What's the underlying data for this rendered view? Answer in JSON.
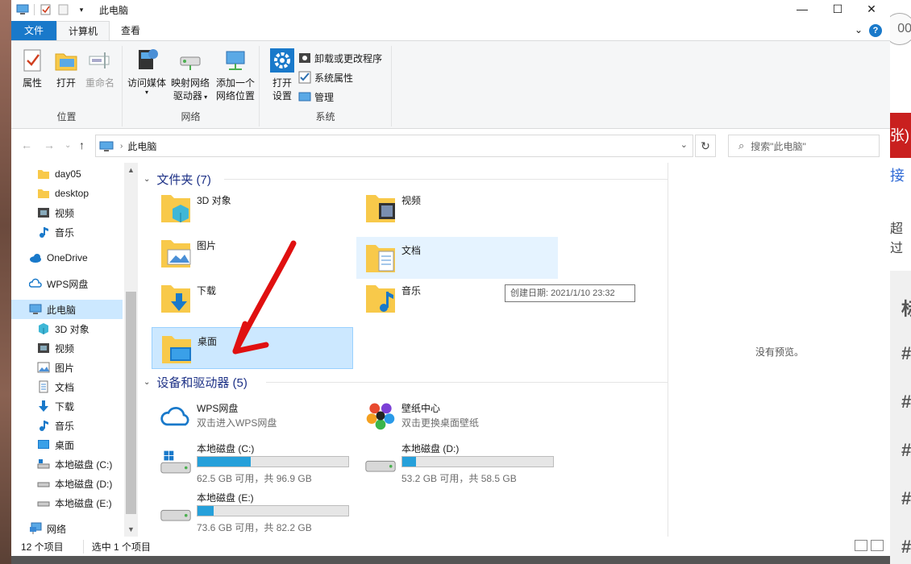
{
  "window": {
    "title": "此电脑",
    "controls": {
      "minimize": "—",
      "maximize": "☐",
      "close": "✕"
    }
  },
  "ribbon_tabs": {
    "file": "文件",
    "computer": "计算机",
    "view": "查看"
  },
  "ribbon": {
    "location": {
      "label": "位置",
      "properties": "属性",
      "open": "打开",
      "rename": "重命名"
    },
    "network": {
      "label": "网络",
      "access_media": "访问媒体",
      "map_drive_line1": "映射网络",
      "map_drive_line2": "驱动器",
      "add_location_line1": "添加一个",
      "add_location_line2": "网络位置"
    },
    "system": {
      "label": "系统",
      "open_settings_line1": "打开",
      "open_settings_line2": "设置",
      "uninstall": "卸载或更改程序",
      "system_props": "系统属性",
      "manage": "管理"
    }
  },
  "address": {
    "crumb": "此电脑",
    "search_placeholder": "搜索\"此电脑\""
  },
  "nav": {
    "items": [
      {
        "label": "day05",
        "icon": "folder-icon"
      },
      {
        "label": "desktop",
        "icon": "folder-icon"
      },
      {
        "label": "视频",
        "icon": "video-icon"
      },
      {
        "label": "音乐",
        "icon": "music-icon"
      },
      {
        "label": "OneDrive",
        "icon": "cloud-icon"
      },
      {
        "label": "WPS网盘",
        "icon": "wps-cloud-icon"
      },
      {
        "label": "此电脑",
        "icon": "computer-icon"
      },
      {
        "label": "3D 对象",
        "icon": "cube-icon"
      },
      {
        "label": "视频",
        "icon": "video-icon"
      },
      {
        "label": "图片",
        "icon": "picture-icon"
      },
      {
        "label": "文档",
        "icon": "document-icon"
      },
      {
        "label": "下载",
        "icon": "download-icon"
      },
      {
        "label": "音乐",
        "icon": "music-icon"
      },
      {
        "label": "桌面",
        "icon": "desktop-icon"
      },
      {
        "label": "本地磁盘 (C:)",
        "icon": "drive-icon"
      },
      {
        "label": "本地磁盘 (D:)",
        "icon": "drive-icon"
      },
      {
        "label": "本地磁盘 (E:)",
        "icon": "drive-icon"
      },
      {
        "label": "网络",
        "icon": "network-icon"
      }
    ]
  },
  "folders_section": {
    "title": "文件夹 (7)",
    "items": [
      {
        "label": "3D 对象",
        "icon": "cube-folder-icon"
      },
      {
        "label": "视频",
        "icon": "video-folder-icon"
      },
      {
        "label": "图片",
        "icon": "picture-folder-icon"
      },
      {
        "label": "文档",
        "icon": "document-folder-icon"
      },
      {
        "label": "下载",
        "icon": "download-folder-icon"
      },
      {
        "label": "音乐",
        "icon": "music-folder-icon"
      },
      {
        "label": "桌面",
        "icon": "desktop-folder-icon"
      }
    ],
    "tooltip": "创建日期: 2021/1/10 23:32"
  },
  "devices_section": {
    "title": "设备和驱动器 (5)",
    "items": [
      {
        "label": "WPS网盘",
        "sub": "双击进入WPS网盘",
        "icon": "wps-cloud-icon"
      },
      {
        "label": "壁纸中心",
        "sub": "双击更换桌面壁纸",
        "icon": "wallpaper-icon"
      },
      {
        "label": "本地磁盘 (C:)",
        "free": "62.5 GB 可用，共 96.9 GB",
        "used_fraction": 0.355,
        "icon": "windows-drive-icon"
      },
      {
        "label": "本地磁盘 (D:)",
        "free": "53.2 GB 可用，共 58.5 GB",
        "used_fraction": 0.09,
        "icon": "drive-icon"
      },
      {
        "label": "本地磁盘 (E:)",
        "free": "73.6 GB 可用，共 82.2 GB",
        "used_fraction": 0.105,
        "icon": "drive-icon"
      }
    ]
  },
  "preview": {
    "message": "没有预览。"
  },
  "status": {
    "count": "12 个项目",
    "selected": "选中 1 个项目"
  },
  "colors": {
    "accent": "#1979ca",
    "selection": "#cce8ff",
    "hover": "#e5f3ff",
    "drive_fill": "#26a0da",
    "annotation": "#e01010"
  }
}
